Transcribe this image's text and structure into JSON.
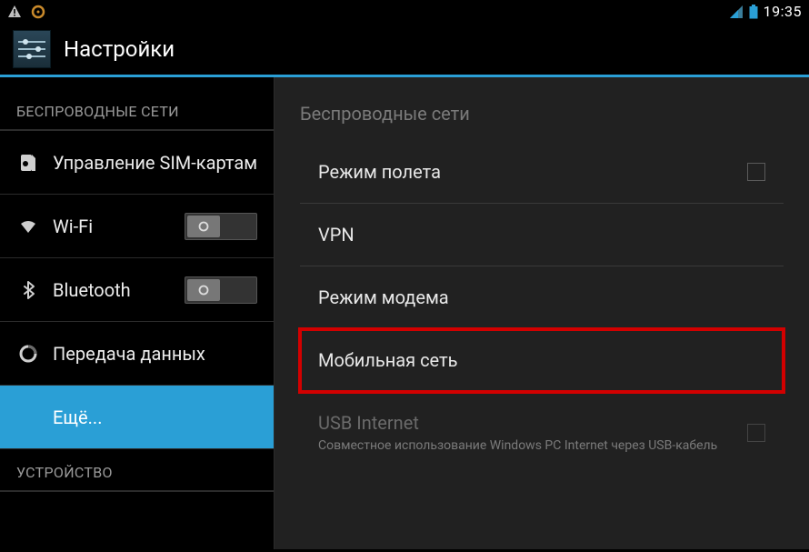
{
  "status": {
    "time": "19:35"
  },
  "header": {
    "title": "Настройки"
  },
  "sidebar": {
    "section_wireless": "БЕСПРОВОДНЫЕ СЕТИ",
    "sim": "Управление SIM-картами",
    "wifi": "Wi-Fi",
    "bluetooth": "Bluetooth",
    "data": "Передача данных",
    "more": "Ещё...",
    "section_device": "УСТРОЙСТВО"
  },
  "content": {
    "header": "Беспроводные сети",
    "airplane": "Режим полета",
    "vpn": "VPN",
    "tether": "Режим модема",
    "mobile": "Мобильная сеть",
    "usb_title": "USB Internet",
    "usb_sub": "Совместное использование Windows PC Internet через USB-кабель"
  }
}
